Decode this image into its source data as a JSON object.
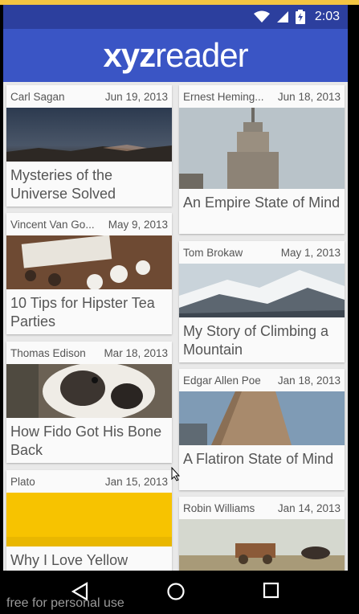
{
  "status_bar": {
    "time": "2:03"
  },
  "app_bar": {
    "logo_bold": "xyz",
    "logo_regular": "reader"
  },
  "articles": [
    {
      "author": "Carl Sagan",
      "date": "Jun 19, 2013",
      "title": "Mysteries of the Universe Solved"
    },
    {
      "author": "Ernest Heming...",
      "date": "Jun 18, 2013",
      "title": "An Empire State of Mind"
    },
    {
      "author": "Vincent Van Go...",
      "date": "May 9, 2013",
      "title": "10 Tips for Hipster Tea Parties"
    },
    {
      "author": "Tom Brokaw",
      "date": "May 1, 2013",
      "title": "My Story of Climbing a Mountain"
    },
    {
      "author": "Thomas Edison",
      "date": "Mar 18, 2013",
      "title": "How Fido Got His Bone Back"
    },
    {
      "author": "Edgar Allen Poe",
      "date": "Jan 18, 2013",
      "title": "A Flatiron State of Mind"
    },
    {
      "author": "Plato",
      "date": "Jan 15, 2013",
      "title": "Why I Love Yellow"
    },
    {
      "author": "Robin Williams",
      "date": "Jan 14, 2013",
      "title": ""
    }
  ],
  "watermark": "free for personal use",
  "colors": {
    "app_bar": "#3a55c5",
    "status_bar": "#2c3f9e",
    "background": "#e9e9e9"
  }
}
